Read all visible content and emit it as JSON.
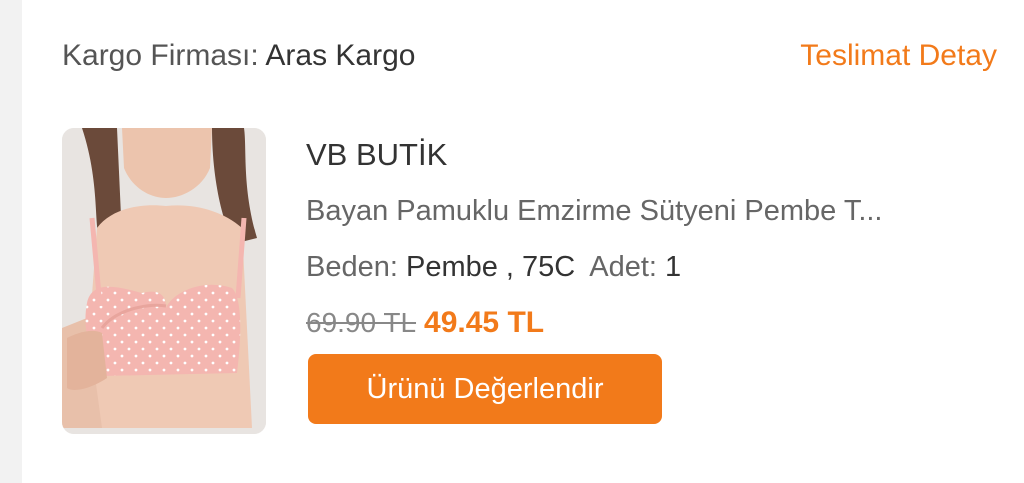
{
  "shipment": {
    "cargo_label": "Kargo Firması",
    "cargo_value": "Aras Kargo",
    "delivery_detail_link": "Teslimat Detay"
  },
  "product": {
    "seller": "VB BUTİK",
    "title": "Bayan Pamuklu Emzirme Sütyeni Pembe T...",
    "size_label": "Beden:",
    "size_value": "Pembe , 75C",
    "quantity_label": "Adet:",
    "quantity_value": "1",
    "old_price": "69.90 TL",
    "new_price": "49.45 TL",
    "review_button": "Ürünü Değerlendir",
    "image_icon": "bra-product-photo"
  },
  "colors": {
    "accent": "#f27a1a",
    "product_pink": "#f4b6b0"
  }
}
